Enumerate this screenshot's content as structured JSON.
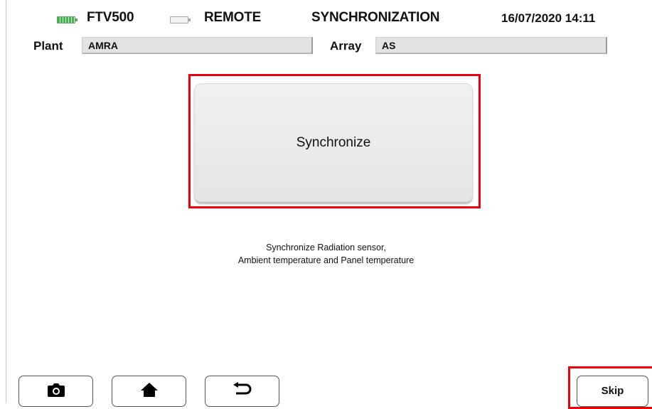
{
  "status_bar": {
    "device": "FTV500",
    "remote": "REMOTE",
    "mode_title": "SYNCHRONIZATION",
    "datetime": "16/07/2020 14:11"
  },
  "fields": {
    "plant_label": "Plant",
    "plant_value": "AMRA",
    "array_label": "Array",
    "array_value": "AS"
  },
  "main": {
    "synchronize_label": "Synchronize",
    "description_line1": "Synchronize Radiation sensor,",
    "description_line2": "Ambient temperature and Panel temperature"
  },
  "footer": {
    "skip_label": "Skip"
  },
  "icons": {
    "battery_device": "battery-full-icon",
    "battery_remote": "battery-empty-icon",
    "camera": "camera-icon",
    "home": "home-icon",
    "back": "back-arrow-icon"
  },
  "colors": {
    "highlight": "#e8000b",
    "battery_charge": "#3fb64a",
    "button_face": "#ebecec"
  }
}
